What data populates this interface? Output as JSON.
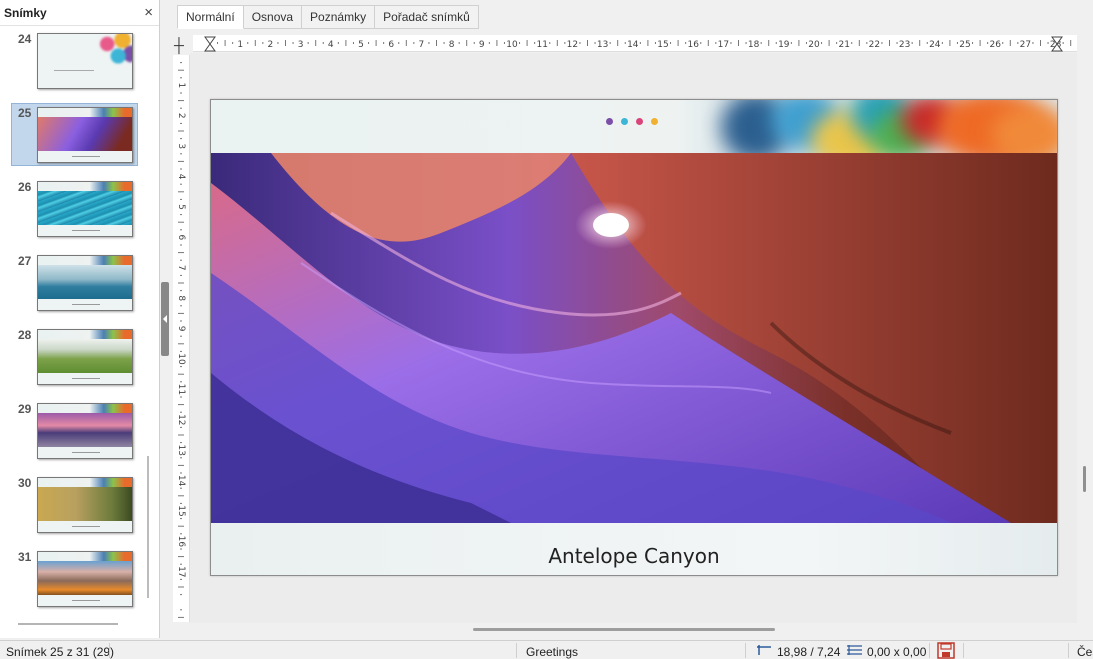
{
  "slide_panel": {
    "title": "Snímky",
    "close_label": "×",
    "items": [
      {
        "number": "24",
        "theme": "candy"
      },
      {
        "number": "25",
        "theme": "canyon",
        "selected": true
      },
      {
        "number": "26",
        "theme": "water"
      },
      {
        "number": "27",
        "theme": "lake"
      },
      {
        "number": "28",
        "theme": "grass"
      },
      {
        "number": "29",
        "theme": "desert"
      },
      {
        "number": "30",
        "theme": "golden"
      },
      {
        "number": "31",
        "theme": "mountain"
      }
    ]
  },
  "tabs": [
    "Normální",
    "Osnova",
    "Poznámky",
    "Pořadač snímků"
  ],
  "active_tab": "Normální",
  "ruler": {
    "horizontal": [
      "1",
      "2",
      "3",
      "4",
      "5",
      "6",
      "7",
      "8",
      "9",
      "10",
      "11",
      "12",
      "13",
      "14",
      "15",
      "16",
      "17",
      "18",
      "19",
      "20",
      "21",
      "22",
      "23",
      "24",
      "25",
      "26",
      "27",
      "28"
    ],
    "vertical": [
      "1",
      "2",
      "3",
      "4",
      "5",
      "6",
      "7",
      "8",
      "9",
      "10",
      "11",
      "12",
      "13",
      "14",
      "15",
      "16",
      "17"
    ]
  },
  "slide": {
    "caption": "Antelope Canyon",
    "dot_colors": [
      "#7b4fa8",
      "#3db5d6",
      "#d9457a",
      "#f0b030"
    ]
  },
  "statusbar": {
    "slide_info": "Snímek 25 z 31 (29)",
    "master": "Greetings",
    "position": "18,98 / 7,24",
    "size": "0,00 x 0,00",
    "language": "Češ"
  }
}
